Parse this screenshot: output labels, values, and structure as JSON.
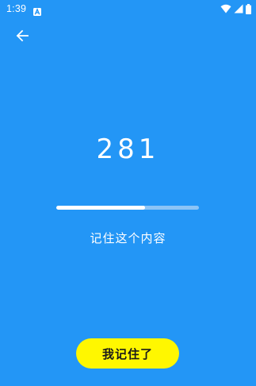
{
  "status_bar": {
    "time": "1:39",
    "notification_icon": "a-notification-icon",
    "wifi_icon": "wifi-icon",
    "signal_icon": "cell-signal-icon",
    "battery_icon": "battery-icon"
  },
  "header": {
    "back_icon": "arrow-left-icon"
  },
  "main": {
    "number": "281",
    "progress_fraction": 0.62,
    "instruction": "记住这个内容"
  },
  "actions": {
    "remember_label": "我记住了"
  },
  "colors": {
    "background": "#2396F6",
    "progress_fill": "#FFFFFF",
    "progress_track": "#8CC4F6",
    "button_background": "#FFF700",
    "button_text": "#1A1A1A"
  }
}
